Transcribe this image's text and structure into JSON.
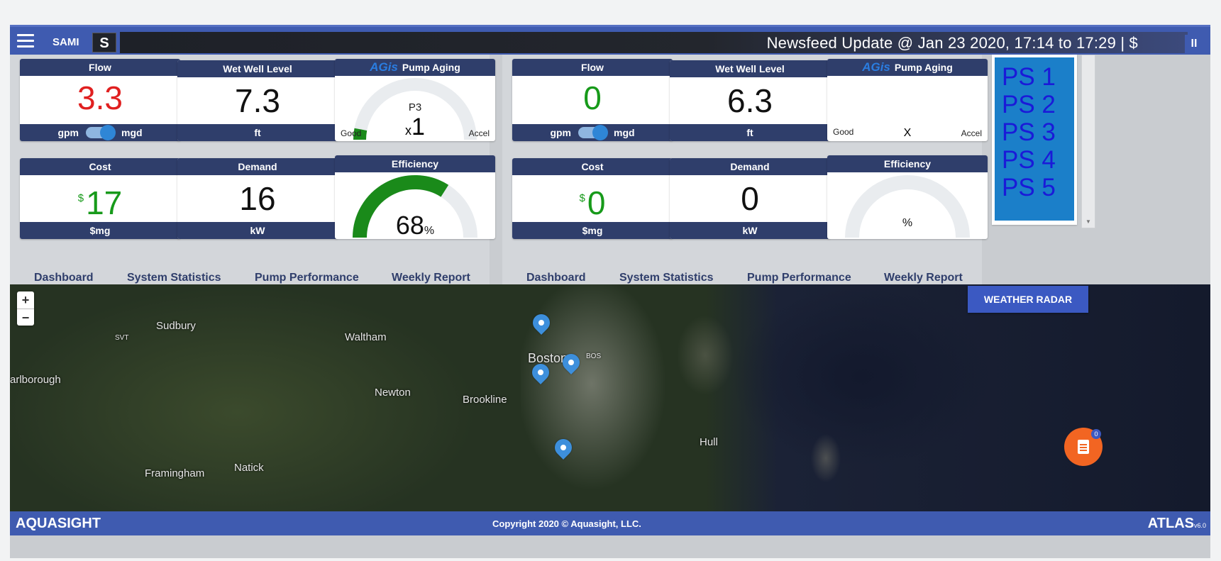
{
  "topbar": {
    "app_name": "SAMI",
    "s_label": "S",
    "ticker": "Newsfeed Update @ Jan 23 2020, 17:14 to 17:29   |   $",
    "pause": "II"
  },
  "stations": [
    {
      "flow": {
        "title": "Flow",
        "value": "3.3",
        "unit_left": "gpm",
        "unit_right": "mgd"
      },
      "wet_well": {
        "title": "Wet Well Level",
        "value": "7.3",
        "unit": "ft"
      },
      "aging": {
        "brand": "AGis",
        "title": "Pump Aging",
        "pump": "P3",
        "multiplier": "x",
        "value": "1",
        "left": "Good",
        "right": "Accel",
        "level": 0.05
      },
      "cost": {
        "title": "Cost",
        "currency": "$",
        "value": "17",
        "unit": "$mg"
      },
      "demand": {
        "title": "Demand",
        "value": "16",
        "unit": "kW"
      },
      "efficiency": {
        "title": "Efficiency",
        "value": "68",
        "unit": "%",
        "level": 0.68
      },
      "nav": [
        "Dashboard",
        "System Statistics",
        "Pump Performance",
        "Weekly Report"
      ]
    },
    {
      "flow": {
        "title": "Flow",
        "value": "0",
        "unit_left": "gpm",
        "unit_right": "mgd"
      },
      "wet_well": {
        "title": "Wet Well Level",
        "value": "6.3",
        "unit": "ft"
      },
      "aging": {
        "brand": "AGis",
        "title": "Pump Aging",
        "pump": "",
        "multiplier": "X",
        "value": "",
        "left": "Good",
        "right": "Accel",
        "level": 0
      },
      "cost": {
        "title": "Cost",
        "currency": "$",
        "value": "0",
        "unit": "$mg"
      },
      "demand": {
        "title": "Demand",
        "value": "0",
        "unit": "kW"
      },
      "efficiency": {
        "title": "Efficiency",
        "value": "",
        "unit": "%",
        "level": 0
      },
      "nav": [
        "Dashboard",
        "System Statistics",
        "Pump Performance",
        "Weekly Report"
      ]
    }
  ],
  "pump_stations": [
    "PS 1",
    "PS 2",
    "PS 3",
    "PS 4",
    "PS 5"
  ],
  "map": {
    "zoom_in": "+",
    "zoom_out": "−",
    "weather_button": "WEATHER RADAR",
    "places": [
      "Sudbury",
      "SVT",
      "Waltham",
      "arlborough",
      "Newton",
      "Brookline",
      "Boston",
      "BOS",
      "Hull",
      "Framingham",
      "Natick"
    ],
    "chat_badge": "0"
  },
  "footer": {
    "left": "AQUASIGHT",
    "copyright": "Copyright 2020 © Aquasight, LLC.",
    "right": "ATLAS",
    "version": "v6.0"
  },
  "colors": {
    "header": "#3f5bb0",
    "widget_bar": "#2f3e6b",
    "red_value": "#e02020",
    "green_value": "#179a1a",
    "ps_bg": "#1b7fc9",
    "ps_text": "#1a1ad8",
    "gauge_green": "#1a8a1a",
    "chat": "#f26522"
  }
}
